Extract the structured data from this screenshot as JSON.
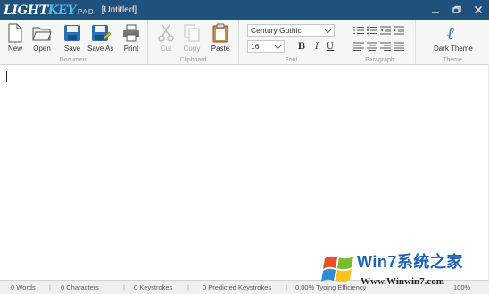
{
  "titlebar": {
    "logo_part1": "LIGHT",
    "logo_part2": "KEY",
    "logo_part3": "PAD",
    "doc_title": "[Untitled]",
    "controls": [
      "minimize",
      "restore",
      "close"
    ]
  },
  "ribbon": {
    "groups": {
      "document": "Document",
      "clipboard": "Clipboard",
      "font": "Font",
      "paragraph": "Paragraph",
      "theme": "Theme"
    },
    "buttons": {
      "new": "New",
      "open": "Open",
      "save": "Save",
      "save_as": "Save As",
      "print": "Print",
      "cut": "Cut",
      "copy": "Copy",
      "paste": "Paste",
      "dark_theme": "Dark Theme"
    },
    "font": {
      "family": "Century Gothic",
      "size": "16",
      "bold": "B",
      "italic": "I",
      "underline": "U"
    },
    "colors": {
      "accent": "#20507c",
      "theme_icon": "#3a7fc4"
    }
  },
  "editor": {
    "content": ""
  },
  "status": {
    "words": "0 Words",
    "characters": "0 Characters",
    "keystrokes": "0 Keystrokes",
    "predicted": "0 Predicted Keystrokes",
    "efficiency": "0.00% Typing Efficiency",
    "zoom": "100%"
  },
  "watermark": {
    "line1": "Win7系统之家",
    "line2": "Www.Winwin7.com"
  }
}
